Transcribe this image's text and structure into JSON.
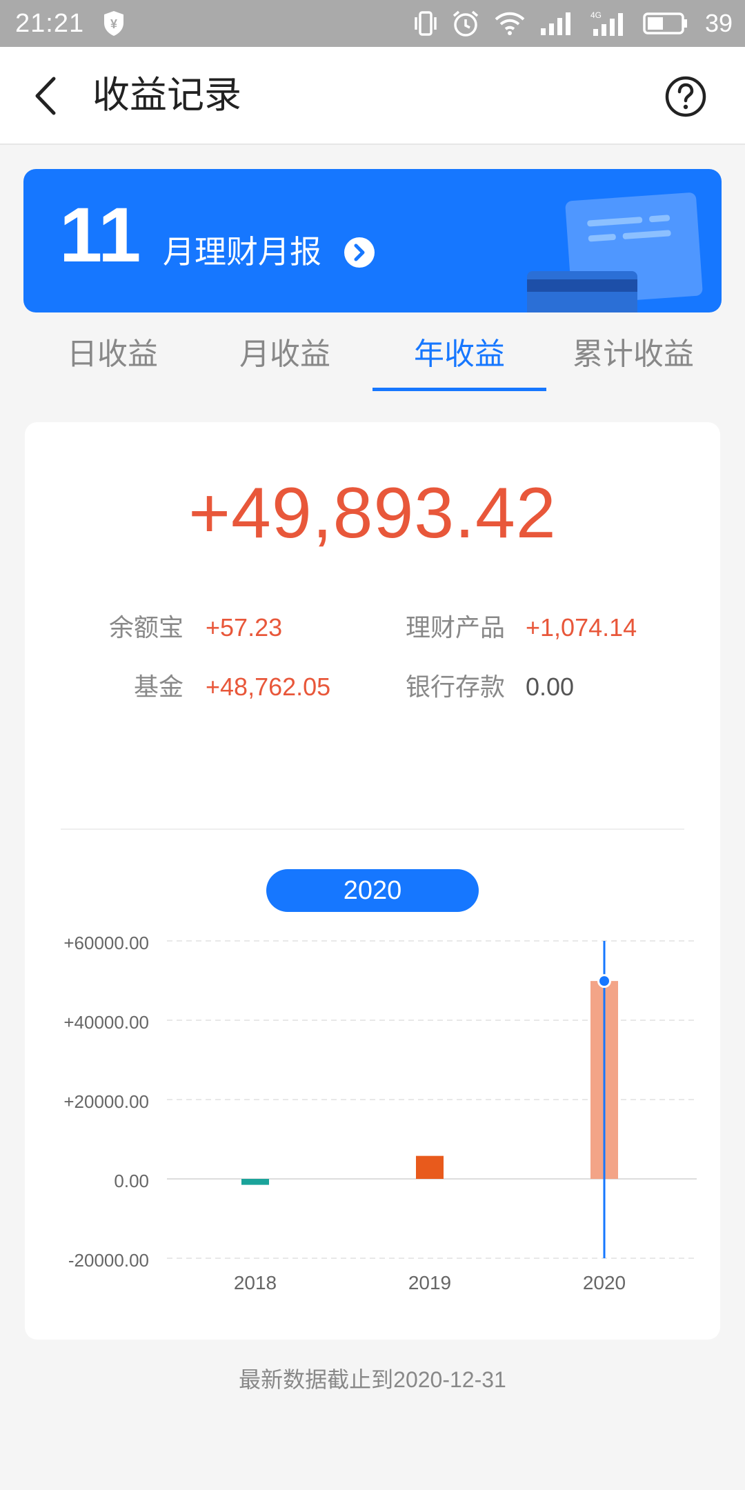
{
  "status_bar": {
    "time": "21:21",
    "battery": "39",
    "icons": [
      "shield-yen-icon",
      "vibrate-icon",
      "alarm-icon",
      "wifi-icon",
      "signal-icon",
      "4g-signal-icon",
      "battery-icon"
    ]
  },
  "header": {
    "title": "收益记录",
    "back_icon": "chevron-left-icon",
    "help_icon": "question-circle-icon"
  },
  "banner": {
    "month": "11",
    "text": "月理财月报",
    "color": "#1677ff"
  },
  "tabs": [
    {
      "label": "日收益",
      "active": false
    },
    {
      "label": "月收益",
      "active": false
    },
    {
      "label": "年收益",
      "active": true
    },
    {
      "label": "累计收益",
      "active": false
    }
  ],
  "summary": {
    "total": "+49,893.42",
    "items": [
      {
        "label": "余额宝",
        "value": "+57.23"
      },
      {
        "label": "理财产品",
        "value": "+1,074.14"
      },
      {
        "label": "基金",
        "value": "+48,762.05"
      },
      {
        "label": "银行存款",
        "value": "0.00"
      }
    ]
  },
  "selected_year": "2020",
  "chart_data": {
    "type": "bar",
    "categories": [
      "2018",
      "2019",
      "2020"
    ],
    "values": [
      -1500,
      5800,
      49893.42
    ],
    "bar_colors": [
      "#1aa39a",
      "#e85a1c",
      "#f3a487"
    ],
    "y_ticks": [
      "+60000.00",
      "+40000.00",
      "+20000.00",
      "0.00",
      "-20000.00"
    ],
    "y_tick_values": [
      60000,
      40000,
      20000,
      0,
      -20000
    ],
    "ylim": [
      -20000,
      60000
    ],
    "highlight_category": "2020",
    "highlight_color": "#1677ff"
  },
  "footnote": "最新数据截止到2020-12-31"
}
